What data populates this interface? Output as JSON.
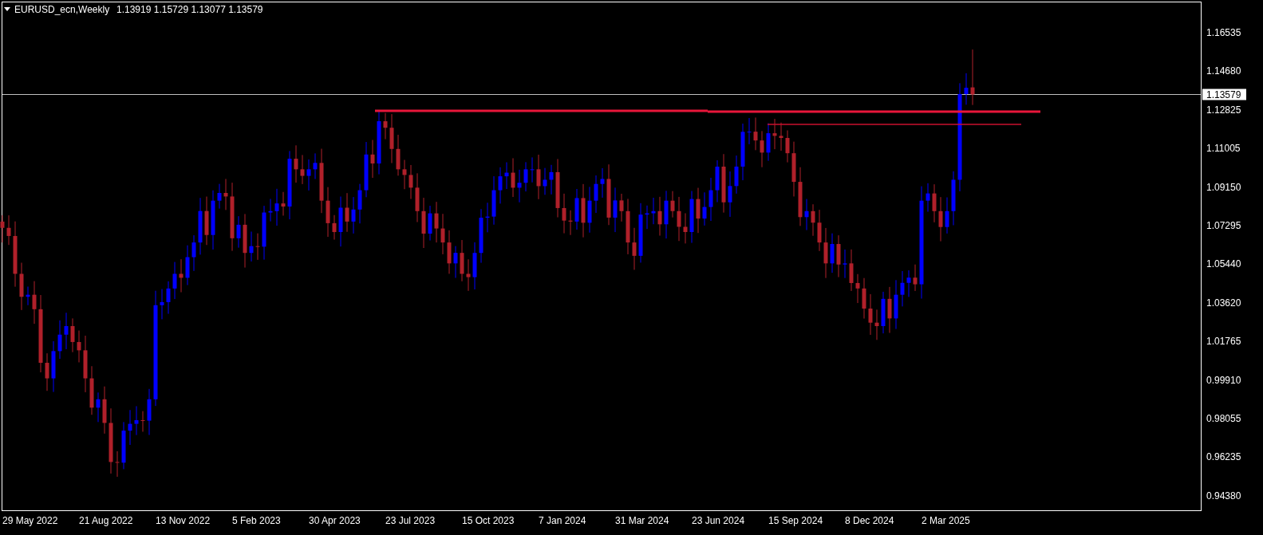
{
  "chart": {
    "symbol": "EURUSD_ecn,Weekly",
    "ohlc": [
      "1.13919",
      "1.15729",
      "1.13077",
      "1.13579"
    ]
  },
  "price_axis": {
    "labels": [
      "1.16535",
      "1.14680",
      "1.12825",
      "1.11005",
      "1.09150",
      "1.07295",
      "1.05440",
      "1.03620",
      "1.01765",
      "0.99910",
      "0.98055",
      "0.96235",
      "0.94380"
    ],
    "current_price": "1.13579"
  },
  "time_axis": {
    "labels": [
      "29 May 2022",
      "21 Aug 2022",
      "13 Nov 2022",
      "5 Feb 2023",
      "30 Apr 2023",
      "23 Jul 2023",
      "15 Oct 2023",
      "7 Jan 2024",
      "31 Mar 2024",
      "23 Jun 2024",
      "15 Sep 2024",
      "8 Dec 2024",
      "2 Mar 2025"
    ]
  }
}
